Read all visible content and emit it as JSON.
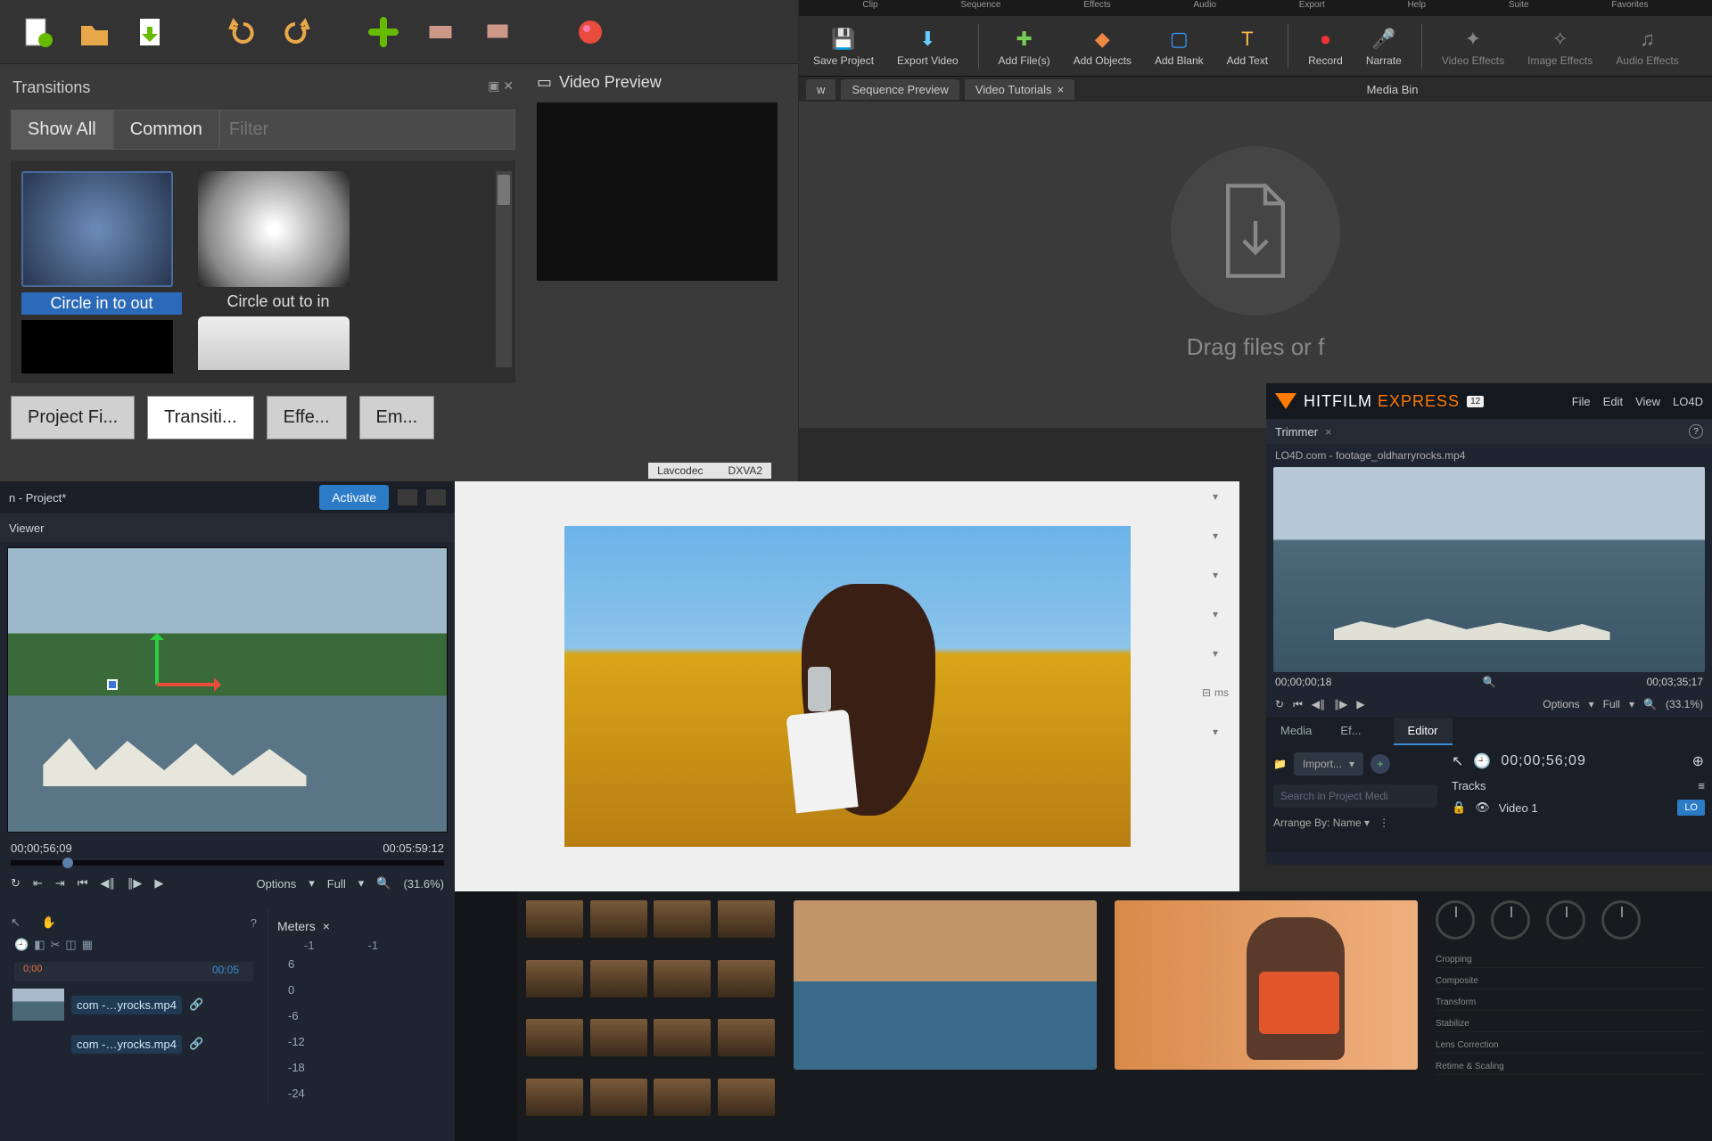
{
  "openshot": {
    "panes": {
      "transitions": "Transitions",
      "preview": "Video Preview"
    },
    "tabs": {
      "show_all": "Show All",
      "common": "Common"
    },
    "filter_placeholder": "Filter",
    "items": {
      "circle_in_out": "Circle in to out",
      "circle_out_in": "Circle out to in"
    },
    "bottom_tabs": {
      "project": "Project Fi...",
      "transitions": "Transiti...",
      "effects": "Effe...",
      "emoji": "Em..."
    },
    "footer": {
      "lavcodec": "Lavcodec",
      "dxva2": "DXVA2"
    }
  },
  "videopad": {
    "menu": [
      "Clip",
      "Sequence",
      "Effects",
      "Audio",
      "Export",
      "Help",
      "Suite",
      "Favorites"
    ],
    "buttons": {
      "save": "Save Project",
      "export": "Export Video",
      "add_files": "Add File(s)",
      "add_objects": "Add Objects",
      "add_blank": "Add Blank",
      "add_text": "Add Text",
      "record": "Record",
      "narrate": "Narrate",
      "video_effects": "Video Effects",
      "image_effects": "Image Effects",
      "audio_effects": "Audio Effects"
    },
    "tabs": {
      "w": "w",
      "sequence_preview": "Sequence Preview",
      "video_tutorials": "Video Tutorials"
    },
    "bin_label": "Media Bin",
    "drop_text": "Drag files or f"
  },
  "hitfilm": {
    "brand": {
      "name_a": "HITFILM",
      "name_b": "EXPRESS",
      "badge": "12",
      "suffix": "LO4D"
    },
    "menu": [
      "File",
      "Edit",
      "View"
    ],
    "trimmer": {
      "title": "Trimmer",
      "clip": "LO4D.com - footage_oldharryrocks.mp4"
    },
    "time": {
      "in": "00;00;00;18",
      "out": "00;03;35;17"
    },
    "controls": {
      "options": "Options",
      "quality": "Full",
      "zoom": "(33.1%)"
    },
    "tabs": {
      "media": "Media",
      "ef": "Ef...",
      "editor": "Editor"
    },
    "media": {
      "import": "Import...",
      "search_placeholder": "Search in Project Medi",
      "arrange": "Arrange By: Name"
    },
    "editor": {
      "timecode": "00;00;56;09",
      "tracks_label": "Tracks",
      "track1": "Video 1",
      "chip": "LO"
    }
  },
  "hfproject": {
    "title": "n - Project*",
    "activate": "Activate",
    "viewer_title": "Viewer",
    "time": {
      "cur": "00;00;56;09",
      "dur": "00:05:59:12"
    },
    "controls": {
      "options": "Options",
      "quality": "Full",
      "zoom": "(31.6%)"
    },
    "meters": {
      "title": "Meters",
      "scale": [
        "-1",
        "-1"
      ],
      "db": [
        "6",
        "0",
        "-6",
        "-12",
        "-18",
        "-24"
      ]
    },
    "timeline": {
      "left": "0;00",
      "right": "00:05"
    },
    "clips": [
      "com -…yrocks.mp4",
      "com -…yrocks.mp4"
    ]
  },
  "center_panel": {
    "unit": "ms"
  },
  "davinci": {
    "knob_labels": [
      "",
      "",
      "",
      ""
    ],
    "rows": [
      "Cropping",
      "Composite",
      "Transform",
      "Stabilize",
      "Lens Correction",
      "Retime & Scaling"
    ]
  }
}
